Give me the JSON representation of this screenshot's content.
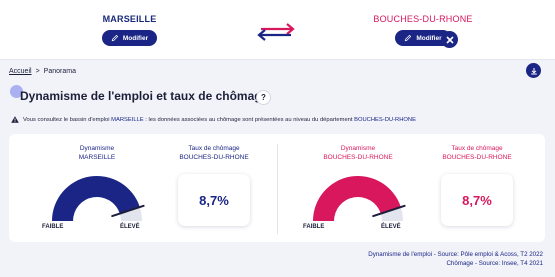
{
  "compare": {
    "left_location": "MARSEILLE",
    "right_location": "BOUCHES-DU-RHONE",
    "modifier_label": "Modifier"
  },
  "breadcrumb": {
    "home": "Accueil",
    "separator": ">",
    "current": "Panorama"
  },
  "section": {
    "title": "Dynamisme de l'emploi et taux de chômage",
    "help": "?",
    "notice_pre": "Vous consultez le bassin d'emploi ",
    "notice_link1": "MARSEILLE",
    "notice_mid": " : les données associées au chômage sont présentées au niveau du département ",
    "notice_link2": "BOUCHES-DU-RHONE"
  },
  "left": {
    "gauge_title": "Dynamisme",
    "gauge_place": "MARSEILLE",
    "gauge_low": "FAIBLE",
    "gauge_high": "ÉLEVÉ",
    "gauge_level": 0.9,
    "rate_title": "Taux de chômage",
    "rate_place": "BOUCHES-DU-RHONE",
    "rate_value": "8,7%"
  },
  "right": {
    "gauge_title": "Dynamisme",
    "gauge_place": "BOUCHES-DU-RHONE",
    "gauge_low": "FAIBLE",
    "gauge_high": "ÉLEVÉ",
    "gauge_level": 0.9,
    "rate_title": "Taux de chômage",
    "rate_place": "BOUCHES-DU-RHONE",
    "rate_value": "8,7%"
  },
  "sources": {
    "line1": "Dynamisme de l'emploi - Source: Pôle emploi & Acoss, T2 2022",
    "line2": "Chômage - Source: Insee, T4 2021"
  },
  "colors": {
    "navy": "#1b2585",
    "pink": "#d8175c"
  }
}
